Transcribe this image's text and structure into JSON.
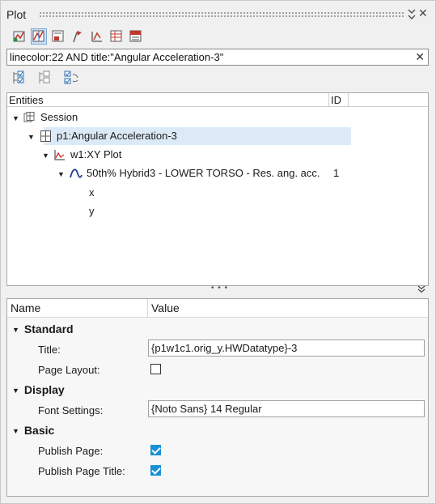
{
  "panel": {
    "title": "Plot"
  },
  "search": {
    "value": "linecolor:22 AND title:\"Angular Acceleration-3\""
  },
  "tree": {
    "columns": {
      "entities": "Entities",
      "id": "ID"
    },
    "session_label": "Session",
    "page_label": "p1:Angular Acceleration-3",
    "window_label": "w1:XY Plot",
    "curve_label": "50th% Hybrid3   - LOWER TORSO - Res. ang. acc.",
    "curve_id": "1",
    "x_label": "x",
    "y_label": "y"
  },
  "props": {
    "columns": {
      "name": "Name",
      "value": "Value"
    },
    "standard": {
      "label": "Standard",
      "title_label": "Title:",
      "title_value": "{p1w1c1.orig_y.HWDatatype}-3",
      "page_layout_label": "Page Layout:",
      "page_layout_checked": false
    },
    "display": {
      "label": "Display",
      "font_label": "Font Settings:",
      "font_value": "{Noto Sans} 14 Regular"
    },
    "basic": {
      "label": "Basic",
      "publish_page_label": "Publish Page:",
      "publish_page_checked": true,
      "publish_title_label": "Publish Page Title:",
      "publish_title_checked": true
    }
  },
  "colors": {
    "accent": "#1a8fd6",
    "selection": "#dceaf7",
    "curve": "#1f3c9c"
  }
}
